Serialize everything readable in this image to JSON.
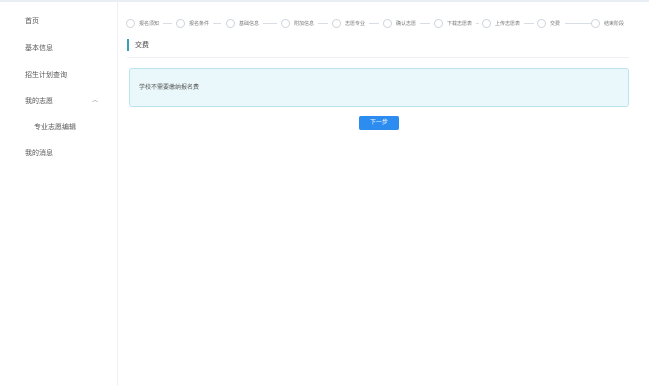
{
  "sidebar": {
    "items": [
      {
        "label": "首页"
      },
      {
        "label": "基本信息"
      },
      {
        "label": "招生计划查询"
      },
      {
        "label": "我的志愿"
      },
      {
        "label": "专业志愿编辑"
      },
      {
        "label": "我的消息"
      }
    ]
  },
  "steps": [
    {
      "label": "报名须知"
    },
    {
      "label": "报名条件"
    },
    {
      "label": "基础信息"
    },
    {
      "label": "附加信息"
    },
    {
      "label": "志愿专业"
    },
    {
      "label": "确认志愿"
    },
    {
      "label": "下载志愿表"
    },
    {
      "label": "上传志愿表"
    },
    {
      "label": "交费"
    },
    {
      "label": "结束阶段"
    }
  ],
  "main": {
    "section_title": "交费",
    "notice": "学校不需要缴纳报名费",
    "next_button": "下一步"
  },
  "colors": {
    "accent": "#3a9fb8",
    "button": "#2d8cf0",
    "notice_bg": "#eaf8fb",
    "notice_border": "#bde3ec"
  }
}
